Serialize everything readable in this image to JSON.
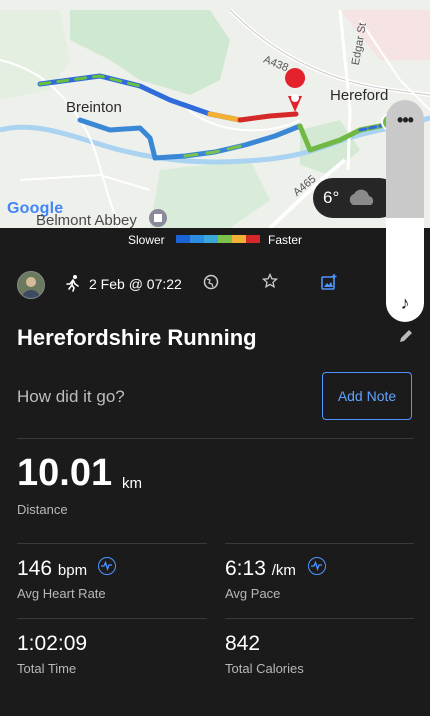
{
  "map": {
    "places": [
      "Breinton",
      "Hereford"
    ],
    "roads": [
      "A438",
      "A465",
      "Edgar St"
    ],
    "attribution": "Google",
    "poi": "Belmont Abbey",
    "weather_temp": "6°"
  },
  "legend": {
    "slower": "Slower",
    "faster": "Faster"
  },
  "activity": {
    "date": "2 Feb @ 07:22",
    "title": "Herefordshire Running",
    "question": "How did it go?",
    "add_note": "Add Note"
  },
  "stats": {
    "distance_value": "10.01",
    "distance_unit": "km",
    "distance_label": "Distance",
    "hr_value": "146",
    "hr_unit": "bpm",
    "hr_label": "Avg Heart Rate",
    "pace_value": "6:13",
    "pace_unit": "/km",
    "pace_label": "Avg Pace",
    "time_value": "1:02:09",
    "time_label": "Total Time",
    "cal_value": "842",
    "cal_label": "Total Calories"
  },
  "colors": {
    "accent": "#4f95ff",
    "background": "#1b1b1b",
    "route_slow": "#1e63d6",
    "route_fast": "#d62828"
  }
}
